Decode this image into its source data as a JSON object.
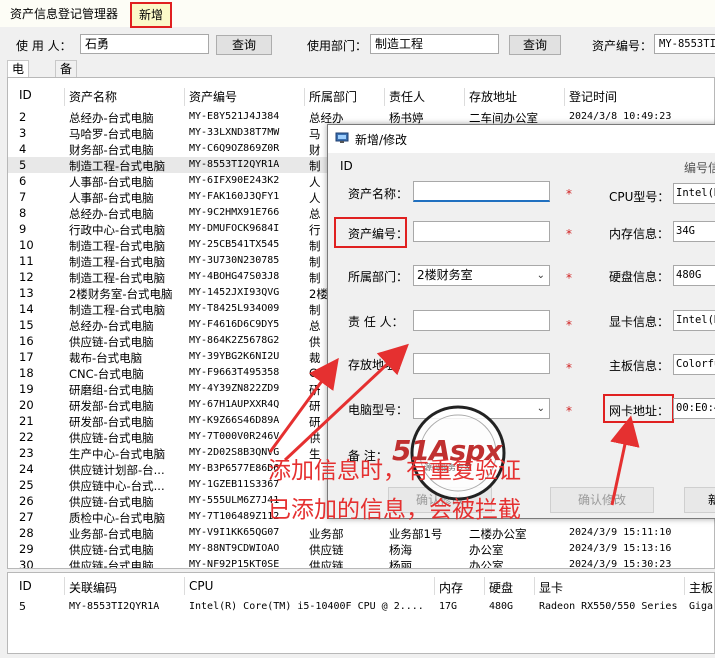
{
  "menubar": {
    "title": "资产信息登记管理器",
    "new_item": "新增"
  },
  "filters": {
    "user_label": "使 用 人：",
    "user_value": "石勇",
    "query1": "查询",
    "dept_label": "使用部门：",
    "dept_value": "制造工程",
    "query2": "查询",
    "asset_label": "资产编号：",
    "asset_value": "MY-8553TI2"
  },
  "tabs": {
    "pc": "电脑类",
    "spare": "备用"
  },
  "grid": {
    "headers": [
      "ID",
      "资产名称",
      "资产编号",
      "所属部门",
      "责任人",
      "存放地址",
      "登记时间"
    ],
    "rows": [
      {
        "id": "2",
        "name": "总经办-台式电脑",
        "code": "MY-E8Y521J4J384",
        "dept": "总经办",
        "owner": "杨书婷",
        "loc": "二车间办公室",
        "time": "2024/3/8 10:49:23"
      },
      {
        "id": "3",
        "name": "马哈罗-台式电脑",
        "code": "MY-33LXND38T7MW",
        "dept": "马",
        "owner": "",
        "loc": "",
        "time": ""
      },
      {
        "id": "4",
        "name": "财务部-台式电脑",
        "code": "MY-C6Q9OZ869Z0R",
        "dept": "财",
        "owner": "",
        "loc": "",
        "time": ""
      },
      {
        "id": "5",
        "name": "制造工程-台式电脑",
        "code": "MY-8553TI2QYR1A",
        "dept": "制",
        "owner": "",
        "loc": "",
        "time": ""
      },
      {
        "id": "6",
        "name": "人事部-台式电脑",
        "code": "MY-6IFX90E243K2",
        "dept": "人",
        "owner": "",
        "loc": "",
        "time": ""
      },
      {
        "id": "7",
        "name": "人事部-台式电脑",
        "code": "MY-FAK160J3QFY1",
        "dept": "人",
        "owner": "",
        "loc": "",
        "time": ""
      },
      {
        "id": "8",
        "name": "总经办-台式电脑",
        "code": "MY-9C2HMX91E766",
        "dept": "总",
        "owner": "",
        "loc": "",
        "time": ""
      },
      {
        "id": "9",
        "name": "行政中心-台式电脑",
        "code": "MY-DMUFOCK9684I",
        "dept": "行",
        "owner": "",
        "loc": "",
        "time": ""
      },
      {
        "id": "10",
        "name": "制造工程-台式电脑",
        "code": "MY-25CB541TX545",
        "dept": "制",
        "owner": "",
        "loc": "",
        "time": ""
      },
      {
        "id": "11",
        "name": "制造工程-台式电脑",
        "code": "MY-3U730N230785",
        "dept": "制",
        "owner": "",
        "loc": "",
        "time": ""
      },
      {
        "id": "12",
        "name": "制造工程-台式电脑",
        "code": "MY-4BOHG47S03J8",
        "dept": "制",
        "owner": "",
        "loc": "",
        "time": ""
      },
      {
        "id": "13",
        "name": "2楼财务室-台式电脑",
        "code": "MY-1452JXI93QVG",
        "dept": "2楼",
        "owner": "",
        "loc": "",
        "time": ""
      },
      {
        "id": "14",
        "name": "制造工程-台式电脑",
        "code": "MY-T8425L934O09",
        "dept": "制",
        "owner": "",
        "loc": "",
        "time": ""
      },
      {
        "id": "15",
        "name": "总经办-台式电脑",
        "code": "MY-F4616D6C9DY5",
        "dept": "总",
        "owner": "",
        "loc": "",
        "time": ""
      },
      {
        "id": "16",
        "name": "供应链-台式电脑",
        "code": "MY-864K2Z5678G2",
        "dept": "供",
        "owner": "",
        "loc": "",
        "time": ""
      },
      {
        "id": "17",
        "name": "裁布-台式电脑",
        "code": "MY-39YBG2K6NI2U",
        "dept": "裁",
        "owner": "",
        "loc": "",
        "time": ""
      },
      {
        "id": "18",
        "name": "CNC-台式电脑",
        "code": "MY-F9663T495358",
        "dept": "CN",
        "owner": "",
        "loc": "",
        "time": ""
      },
      {
        "id": "19",
        "name": "研磨组-台式电脑",
        "code": "MY-4Y39ZN822ZD9",
        "dept": "研",
        "owner": "",
        "loc": "",
        "time": ""
      },
      {
        "id": "20",
        "name": "研发部-台式电脑",
        "code": "MY-67H1AUPXXR4Q",
        "dept": "研",
        "owner": "",
        "loc": "",
        "time": ""
      },
      {
        "id": "21",
        "name": "研发部-台式电脑",
        "code": "MY-K9Z66S46D89A",
        "dept": "研",
        "owner": "",
        "loc": "",
        "time": ""
      },
      {
        "id": "22",
        "name": "供应链-台式电脑",
        "code": "MY-7T000V0R246V",
        "dept": "供",
        "owner": "",
        "loc": "",
        "time": ""
      },
      {
        "id": "23",
        "name": "生产中心-台式电脑",
        "code": "MY-2D02S8B3QNVG",
        "dept": "生",
        "owner": "",
        "loc": "",
        "time": ""
      },
      {
        "id": "24",
        "name": "供应链计划部-台...",
        "code": "MY-B3P6577E86D6",
        "dept": "",
        "owner": "",
        "loc": "",
        "time": ""
      },
      {
        "id": "25",
        "name": "供应链中心-台式...",
        "code": "MY-1GZEB11S3367",
        "dept": "",
        "owner": "",
        "loc": "",
        "time": ""
      },
      {
        "id": "26",
        "name": "供应链-台式电脑",
        "code": "MY-555ULM6Z7J41",
        "dept": "",
        "owner": "",
        "loc": "",
        "time": ""
      },
      {
        "id": "27",
        "name": "质检中心-台式电脑",
        "code": "MY-7T106489Z112",
        "dept": "",
        "owner": "",
        "loc": "",
        "time": ""
      },
      {
        "id": "28",
        "name": "业务部-台式电脑",
        "code": "MY-V9I1KK65QG07",
        "dept": "业务部",
        "owner": "业务部1号",
        "loc": "二楼办公室",
        "time": "2024/3/9 15:11:10"
      },
      {
        "id": "29",
        "name": "供应链-台式电脑",
        "code": "MY-88NT9CDWIOAO",
        "dept": "供应链",
        "owner": "杨海",
        "loc": "办公室",
        "time": "2024/3/9 15:13:16"
      },
      {
        "id": "30",
        "name": "供应链-台式电脑",
        "code": "MY-NF92P15KT0SE",
        "dept": "供应链",
        "owner": "杨丽",
        "loc": "办公室",
        "time": "2024/3/9 15:30:23"
      }
    ]
  },
  "detail": {
    "headers": [
      "ID",
      "关联编码",
      "CPU",
      "内存",
      "硬盘",
      "显卡",
      "主板"
    ],
    "row": {
      "id": "5",
      "code": "MY-8553TI2QYR1A",
      "cpu": "Intel(R) Core(TM) i5-10400F CPU @ 2....",
      "mem": "17G",
      "disk": "480G",
      "gpu": "Radeon RX550/550 Series",
      "board": "Gigab"
    }
  },
  "dialog": {
    "title": "新增/修改",
    "id_label": "ID",
    "right_header": "编号信",
    "name_label": "资产名称：",
    "code_label": "资产编号：",
    "dept_label": "所属部门：",
    "dept_value": "2楼财务室",
    "owner_label": "责 任 人：",
    "loc_label": "存放地址：",
    "model_label": "电脑型号：",
    "note_label": "备 注：",
    "star": "*",
    "cpu_label": "CPU型号：",
    "cpu_value": "Intel(R",
    "mem_label": "内存信息：",
    "mem_value": "34G",
    "disk_label": "硬盘信息：",
    "disk_value": "480G",
    "gpu_label": "显卡信息：",
    "gpu_value": "Intel(R",
    "board_label": "主板信息：",
    "board_value": "Colorfu",
    "mac_label": "网卡地址：",
    "mac_value": "00:E0:4",
    "btn_modify1": "确认修改",
    "btn_modify2": "确认修改",
    "btn_new": "新"
  },
  "annotation": {
    "line1": "添加信息时，有重复验证",
    "line2": "已添加的信息，会被拦截"
  },
  "watermark": {
    "brand": "51Aspx",
    "sub": "源码服务专家"
  },
  "colors": {
    "accent": "#e02020",
    "selected_row": "#e8e8e8",
    "focus": "#2070c0"
  }
}
